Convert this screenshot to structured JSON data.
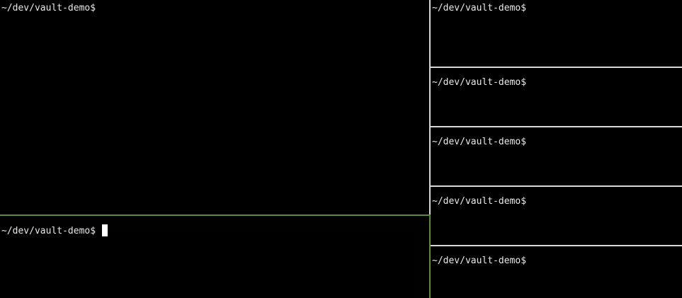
{
  "colors": {
    "background": "#000000",
    "text": "#e8e8e8",
    "active_border": "#5a8a3a",
    "inactive_border": "#d8d8d8",
    "cursor": "#ffffff"
  },
  "panes": {
    "left_top": {
      "prompt": "~/dev/vault-demo$"
    },
    "left_bottom": {
      "prompt": "~/dev/vault-demo$"
    },
    "right_1": {
      "prompt": "~/dev/vault-demo$"
    },
    "right_2": {
      "prompt": "~/dev/vault-demo$"
    },
    "right_3": {
      "prompt": "~/dev/vault-demo$"
    },
    "right_4": {
      "prompt": "~/dev/vault-demo$"
    },
    "right_5": {
      "prompt": "~/dev/vault-demo$"
    }
  }
}
